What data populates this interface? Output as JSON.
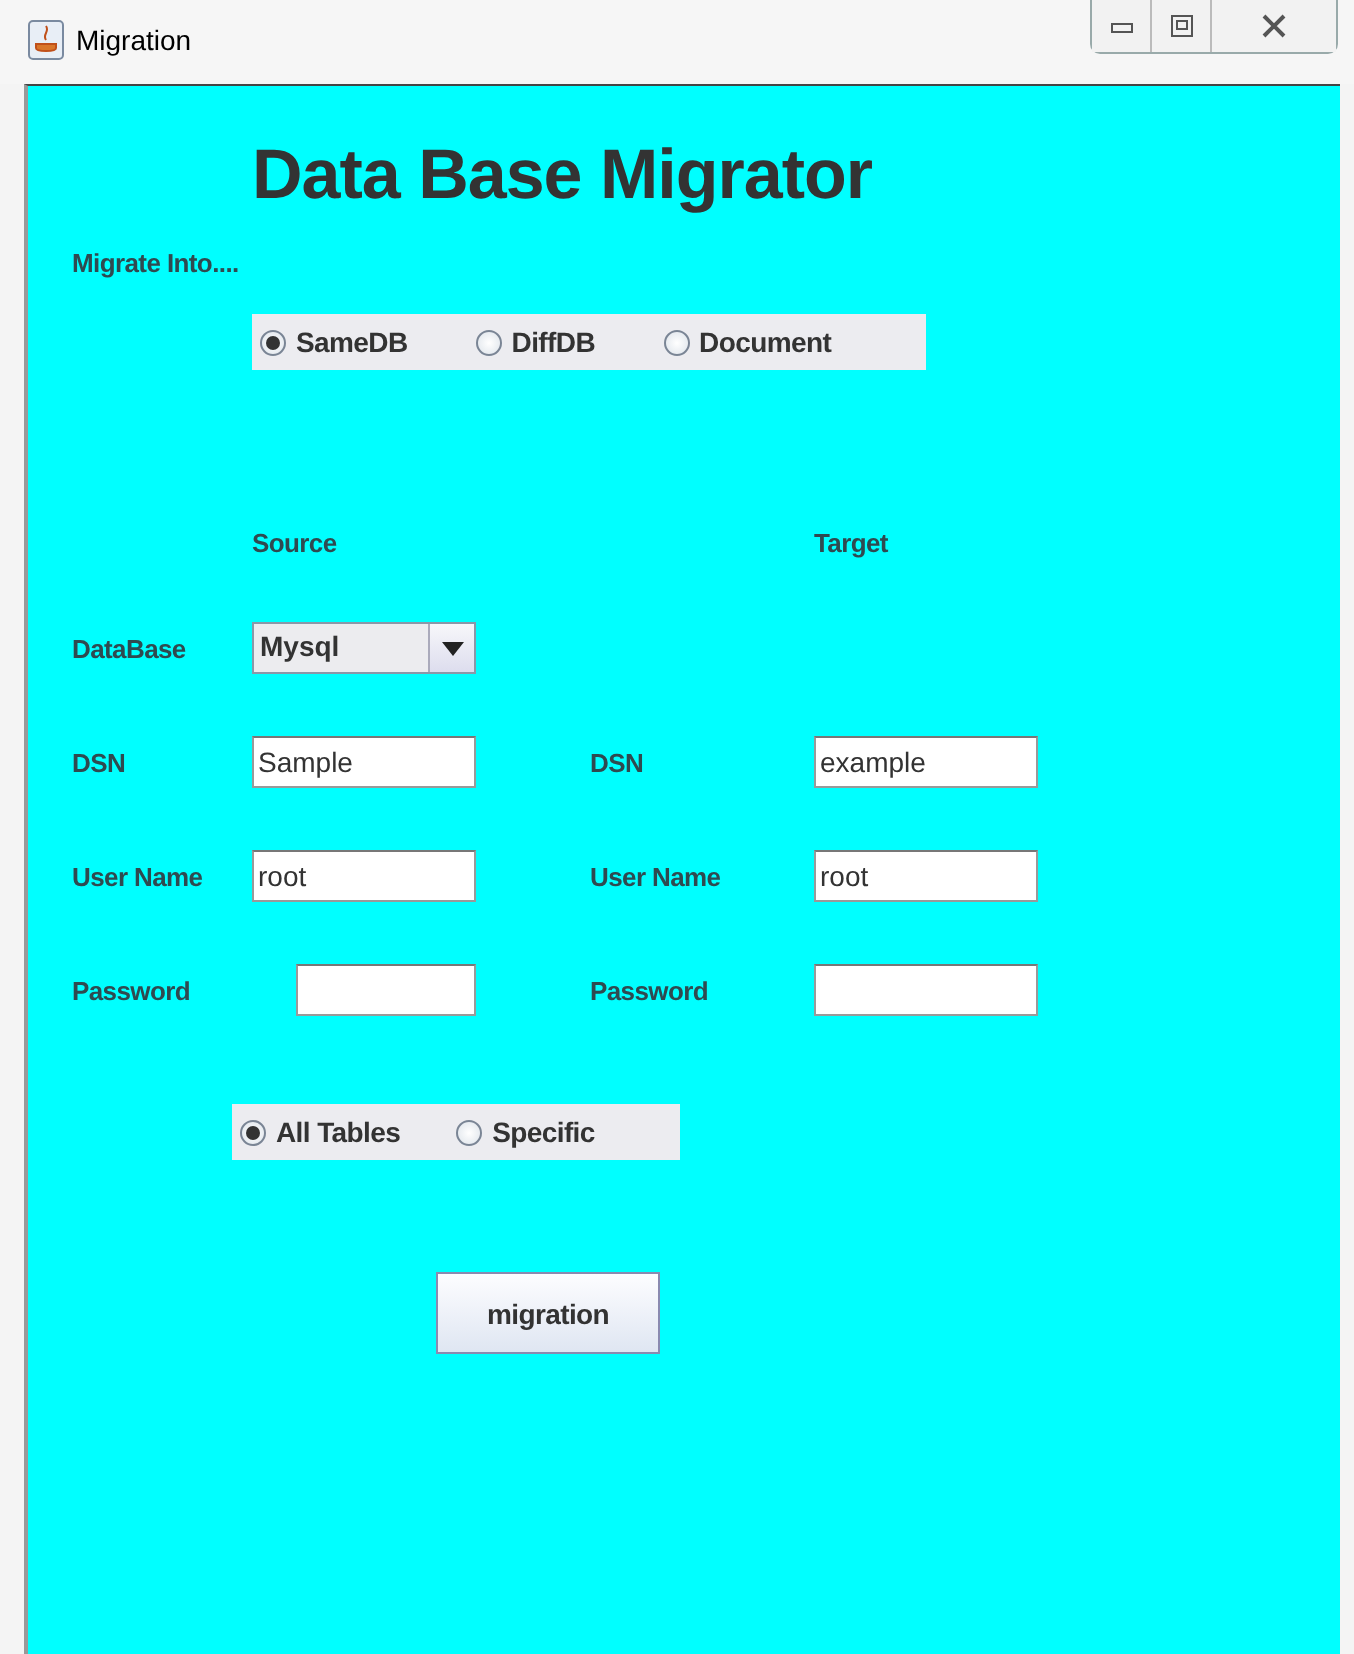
{
  "window": {
    "title": "Migration"
  },
  "heading": "Data Base Migrator",
  "migrate_into": {
    "label": "Migrate Into....",
    "options": [
      {
        "label": "SameDB",
        "selected": true
      },
      {
        "label": "DiffDB",
        "selected": false
      },
      {
        "label": "Document",
        "selected": false
      }
    ]
  },
  "columns": {
    "source": "Source",
    "target": "Target"
  },
  "database": {
    "label": "DataBase",
    "value": "Mysql"
  },
  "rows": [
    {
      "kind": "text",
      "source_label": "DSN",
      "source_value": "Sample",
      "target_label": "DSN",
      "target_value": "example"
    },
    {
      "kind": "text",
      "source_label": "User Name",
      "source_value": "root",
      "target_label": "User Name",
      "target_value": "root"
    },
    {
      "kind": "password",
      "source_label": "Password",
      "target_label": "Password"
    }
  ],
  "table_scope": {
    "options": [
      {
        "label": "All Tables",
        "selected": true
      },
      {
        "label": "Specific",
        "selected": false
      }
    ]
  },
  "button": "migration"
}
